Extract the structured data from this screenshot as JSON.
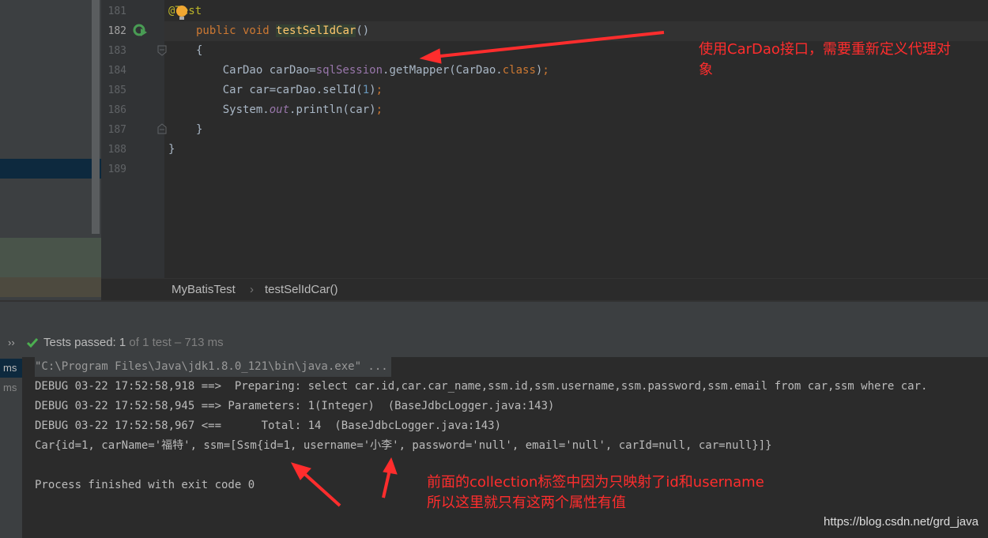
{
  "editor": {
    "lines": [
      {
        "no": "181",
        "parts": [
          [
            "ann",
            "@Test"
          ]
        ]
      },
      {
        "no": "182",
        "parts": [
          [
            "kw",
            "public void "
          ],
          [
            "hl",
            "testSelIdCar"
          ],
          [
            "",
            "()"
          ]
        ]
      },
      {
        "no": "183",
        "parts": [
          [
            "",
            "{"
          ]
        ]
      },
      {
        "no": "184",
        "parts": [
          [
            "",
            "    CarDao carDao="
          ],
          [
            "fld",
            "sqlSession"
          ],
          [
            "",
            ".getMapper(CarDao."
          ],
          [
            "kw",
            "class"
          ],
          [
            "",
            ")"
          ],
          [
            "kw",
            ";"
          ]
        ]
      },
      {
        "no": "185",
        "parts": [
          [
            "",
            "    Car car=carDao.selId("
          ],
          [
            "num",
            "1"
          ],
          [
            "",
            ")"
          ],
          [
            "kw",
            ";"
          ]
        ]
      },
      {
        "no": "186",
        "parts": [
          [
            "",
            "    System."
          ],
          [
            "it",
            "out"
          ],
          [
            "",
            ".println(car)"
          ],
          [
            "kw",
            ";"
          ]
        ]
      },
      {
        "no": "187",
        "parts": [
          [
            "",
            "}"
          ]
        ]
      },
      {
        "no": "188",
        "parts": [
          [
            "",
            "}"
          ]
        ]
      },
      {
        "no": "189",
        "parts": []
      }
    ]
  },
  "breadcrumb": {
    "class": "MyBatisTest",
    "method": "testSelIdCar()"
  },
  "tests": {
    "expand": "››",
    "passed_label": "Tests passed: ",
    "passed_count": "1",
    "rest": " of 1 test – 713 ms"
  },
  "console": {
    "strip": [
      "ms",
      "ms"
    ],
    "lines": [
      "\"C:\\Program Files\\Java\\jdk1.8.0_121\\bin\\java.exe\" ...",
      "DEBUG 03-22 17:52:58,918 ==>  Preparing: select car.id,car.car_name,ssm.id,ssm.username,ssm.password,ssm.email from car,ssm where car.",
      "DEBUG 03-22 17:52:58,945 ==> Parameters: 1(Integer)  (BaseJdbcLogger.java:143)",
      "DEBUG 03-22 17:52:58,967 <==      Total: 14  (BaseJdbcLogger.java:143)",
      "Car{id=1, carName='福特', ssm=[Ssm{id=1, username='小李', password='null', email='null', carId=null, car=null}]}",
      "",
      "Process finished with exit code 0"
    ]
  },
  "annotations": {
    "top": [
      "使用CarDao接口，需要重新定义代理对",
      "象"
    ],
    "bottom": [
      "前面的collection标签中因为只映射了id和username",
      "所以这里就只有这两个属性有值"
    ]
  },
  "watermark": "https://blog.csdn.net/grd_java",
  "colors": {
    "annotation": "#ff2d2d",
    "pass": "#4caf50"
  }
}
